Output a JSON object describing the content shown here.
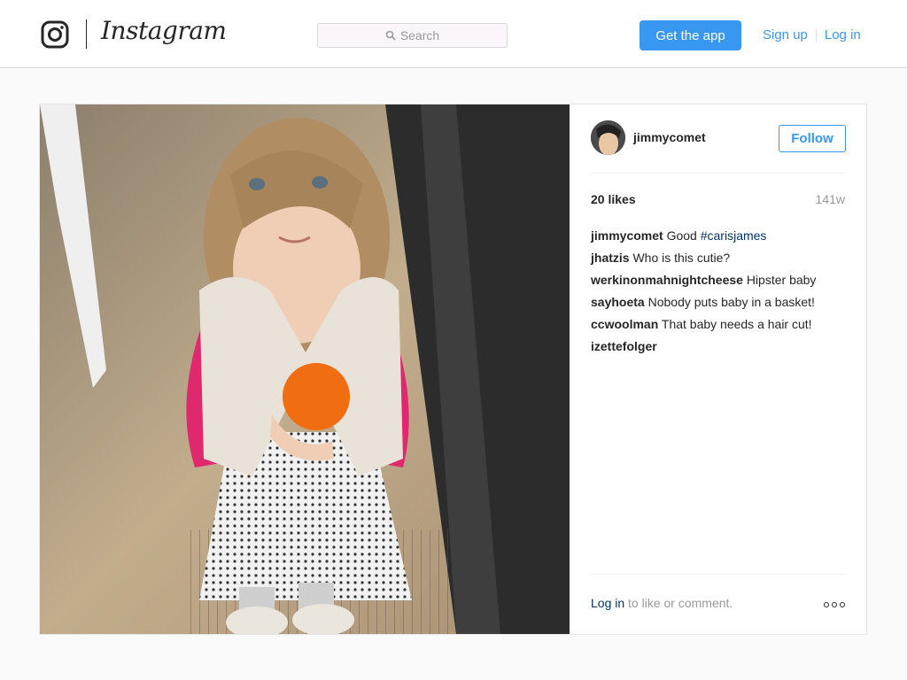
{
  "header": {
    "wordmark": "Instagram",
    "search_placeholder": "Search",
    "get_app_label": "Get the app",
    "signup_label": "Sign up",
    "login_label": "Log in"
  },
  "post": {
    "username": "jimmycomet",
    "follow_label": "Follow",
    "likes": "20 likes",
    "age": "141w",
    "comments": [
      {
        "user": "jimmycomet",
        "text": "Good ",
        "tag": "#carisjames"
      },
      {
        "user": "jhatzis",
        "text": "Who is this cutie?",
        "tag": ""
      },
      {
        "user": "werkinonmahnightcheese",
        "text": "Hipster baby",
        "tag": ""
      },
      {
        "user": "sayhoeta",
        "text": "Nobody puts baby in a basket!",
        "tag": ""
      },
      {
        "user": "ccwoolman",
        "text": "That baby needs a hair cut!",
        "tag": ""
      },
      {
        "user": "izettefolger",
        "text": "",
        "tag": ""
      }
    ],
    "login_link": "Log in",
    "login_suffix": " to like or comment."
  },
  "colors": {
    "accent": "#3897f0",
    "link_dark": "#003569",
    "border": "#dbdbdb"
  },
  "icons": {
    "logo": "instagram-camera-icon",
    "search": "search-icon",
    "more": "more-options-icon"
  }
}
